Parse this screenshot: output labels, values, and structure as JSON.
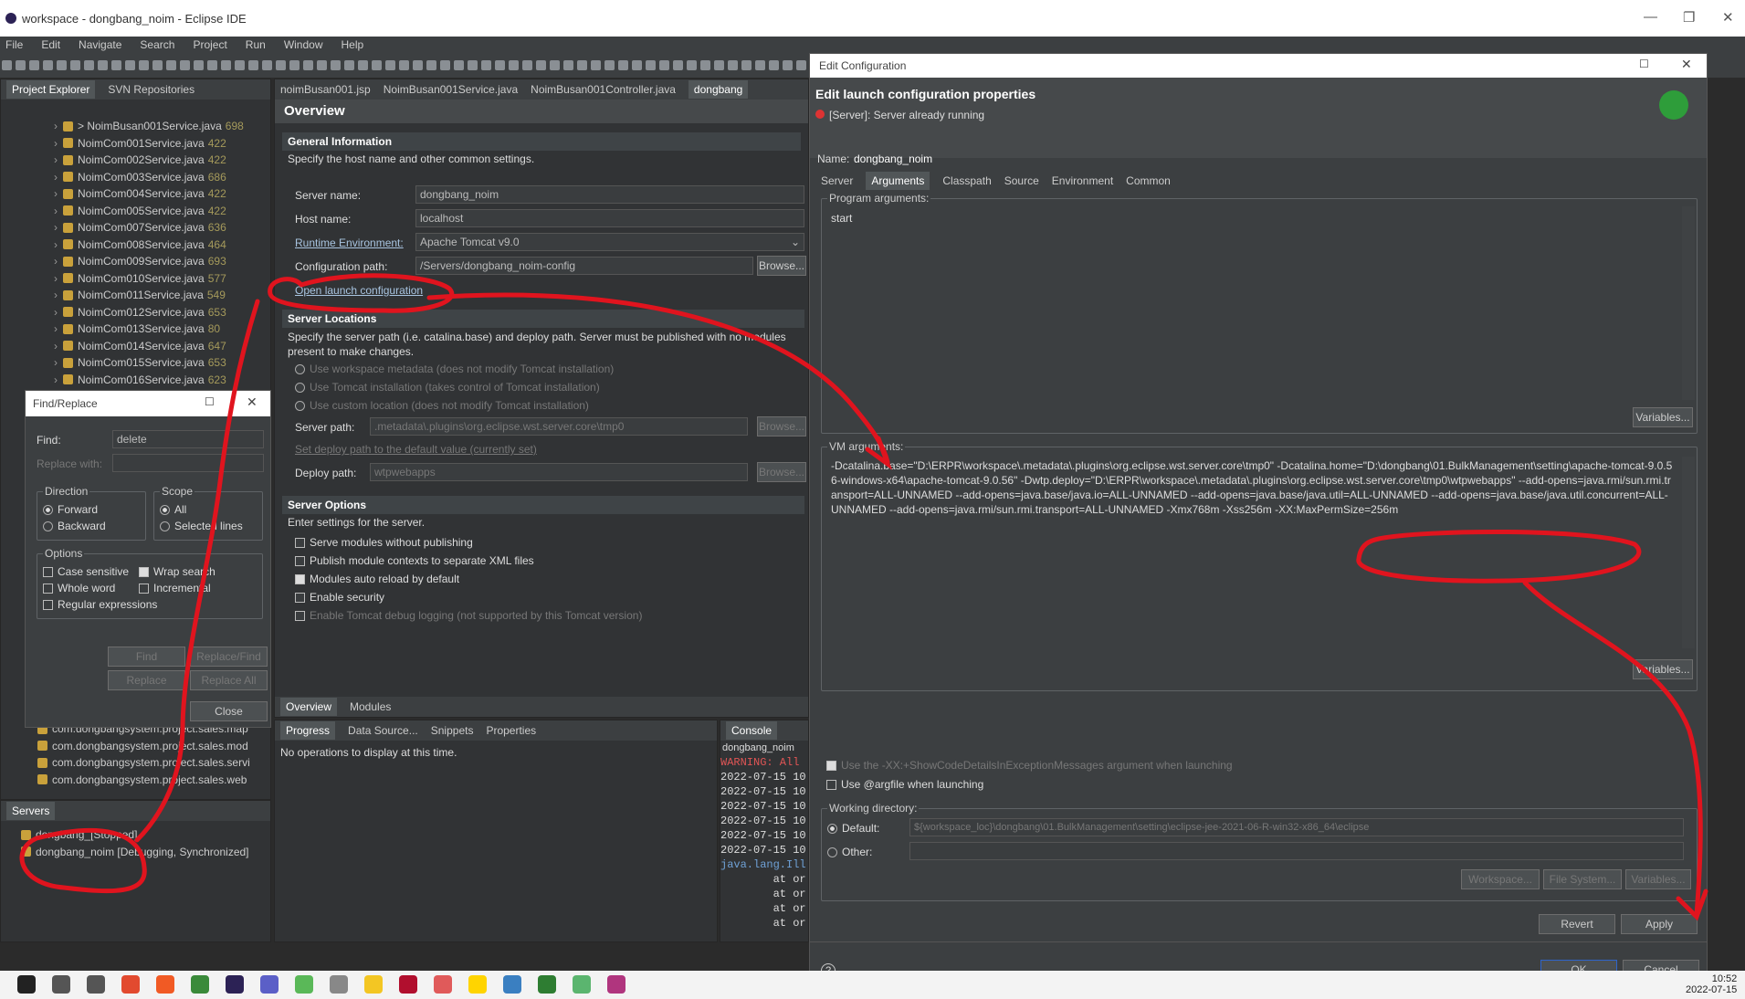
{
  "window": {
    "title": "workspace - dongbang_noim - Eclipse IDE"
  },
  "menu": [
    "File",
    "Edit",
    "Navigate",
    "Search",
    "Project",
    "Run",
    "Window",
    "Help"
  ],
  "explorer": {
    "tabs": [
      "Project Explorer",
      "SVN Repositories"
    ],
    "items": [
      {
        "name": "> NoimBusan001Service.java",
        "num": "698"
      },
      {
        "name": "NoimCom001Service.java",
        "num": "422"
      },
      {
        "name": "NoimCom002Service.java",
        "num": "422"
      },
      {
        "name": "NoimCom003Service.java",
        "num": "686"
      },
      {
        "name": "NoimCom004Service.java",
        "num": "422"
      },
      {
        "name": "NoimCom005Service.java",
        "num": "422"
      },
      {
        "name": "NoimCom007Service.java",
        "num": "636"
      },
      {
        "name": "NoimCom008Service.java",
        "num": "464"
      },
      {
        "name": "NoimCom009Service.java",
        "num": "693"
      },
      {
        "name": "NoimCom010Service.java",
        "num": "577"
      },
      {
        "name": "NoimCom011Service.java",
        "num": "549"
      },
      {
        "name": "NoimCom012Service.java",
        "num": "653"
      },
      {
        "name": "NoimCom013Service.java",
        "num": "80"
      },
      {
        "name": "NoimCom014Service.java",
        "num": "647"
      },
      {
        "name": "NoimCom015Service.java",
        "num": "653"
      },
      {
        "name": "NoimCom016Service.java",
        "num": "623"
      }
    ],
    "packages": [
      "com.dongbangsystem.project.sales.map",
      "com.dongbangsystem.project.sales.mod",
      "com.dongbangsystem.project.sales.servi",
      "com.dongbangsystem.project.sales.web"
    ]
  },
  "servers": {
    "tab": "Servers",
    "items": [
      "dongbang_[Stopped]",
      "dongbang_noim [Debugging, Synchronized]"
    ]
  },
  "findReplace": {
    "title": "Find/Replace",
    "find_label": "Find:",
    "find_value": "delete",
    "replace_label": "Replace with:",
    "direction": "Direction",
    "forward": "Forward",
    "backward": "Backward",
    "scope": "Scope",
    "scope_all": "All",
    "selected_lines": "Selected lines",
    "options": "Options",
    "case_sensitive": "Case sensitive",
    "wrap_search": "Wrap search",
    "whole_word": "Whole word",
    "incremental": "Incremental",
    "regex": "Regular expressions",
    "find_btn": "Find",
    "replace_find_btn": "Replace/Find",
    "replace_btn": "Replace",
    "replace_all_btn": "Replace All",
    "close_btn": "Close"
  },
  "editor": {
    "tabs": [
      "noimBusan001.jsp",
      "NoimBusan001Service.java",
      "NoimBusan001Controller.java",
      "dongbang"
    ],
    "title": "Overview",
    "general": {
      "title": "General Information",
      "desc": "Specify the host name and other common settings.",
      "server_name_label": "Server name:",
      "server_name": "dongbang_noim",
      "host_name_label": "Host name:",
      "host_name": "localhost",
      "runtime_label": "Runtime Environment:",
      "runtime": "Apache Tomcat v9.0",
      "config_label": "Configuration path:",
      "config": "/Servers/dongbang_noim-config",
      "browse": "Browse...",
      "open_launch": "Open launch configuration"
    },
    "locations": {
      "title": "Server Locations",
      "desc": "Specify the server path (i.e. catalina.base) and deploy path. Server must be published with no modules present to make changes.",
      "opt1": "Use workspace metadata (does not modify Tomcat installation)",
      "opt2": "Use Tomcat installation (takes control of Tomcat installation)",
      "opt3": "Use custom location (does not modify Tomcat installation)",
      "server_path_label": "Server path:",
      "server_path": ".metadata\\.plugins\\org.eclipse.wst.server.core\\tmp0",
      "set_default": "Set deploy path to the default value (currently set)",
      "deploy_label": "Deploy path:",
      "deploy": "wtpwebapps"
    },
    "options": {
      "title": "Server Options",
      "desc": "Enter settings for the server.",
      "o1": "Serve modules without publishing",
      "o2": "Publish module contexts to separate XML files",
      "o3": "Modules auto reload by default",
      "o4": "Enable security",
      "o5": "Enable Tomcat debug logging (not supported by this Tomcat version)"
    },
    "bottom_tabs": [
      "Overview",
      "Modules"
    ]
  },
  "bottom": {
    "tabs": [
      "Progress",
      "Data Source...",
      "Snippets",
      "Properties"
    ],
    "msg": "No operations to display at this time.",
    "console_tab": "Console",
    "console_head": "dongbang_noim",
    "console_lines": [
      "WARNING: All",
      "2022-07-15 10",
      "2022-07-15 10",
      "2022-07-15 10",
      "2022-07-15 10",
      "2022-07-15 10",
      "2022-07-15 10",
      "java.lang.Ill",
      "        at or",
      "        at or",
      "        at or",
      "        at or"
    ]
  },
  "dialog": {
    "title": "Edit Configuration",
    "heading": "Edit launch configuration properties",
    "error": "[Server]: Server already running",
    "name_label": "Name:",
    "name": "dongbang_noim",
    "tabs": [
      "Server",
      "Arguments",
      "Classpath",
      "Source",
      "Environment",
      "Common"
    ],
    "program_args_label": "Program arguments:",
    "program_args": "start",
    "variables": "Variables...",
    "vm_args_label": "VM arguments:",
    "vm_args": "-Dcatalina.base=\"D:\\ERPR\\workspace\\.metadata\\.plugins\\org.eclipse.wst.server.core\\tmp0\" -Dcatalina.home=\"D:\\dongbang\\01.BulkManagement\\setting\\apache-tomcat-9.0.56-windows-x64\\apache-tomcat-9.0.56\" -Dwtp.deploy=\"D:\\ERPR\\workspace\\.metadata\\.plugins\\org.eclipse.wst.server.core\\tmp0\\wtpwebapps\" --add-opens=java.rmi/sun.rmi.transport=ALL-UNNAMED --add-opens=java.base/java.io=ALL-UNNAMED --add-opens=java.base/java.util=ALL-UNNAMED --add-opens=java.base/java.util.concurrent=ALL-UNNAMED --add-opens=java.rmi/sun.rmi.transport=ALL-UNNAMED -Xmx768m -Xss256m -XX:MaxPermSize=256m",
    "show_code": "Use the -XX:+ShowCodeDetailsInExceptionMessages argument when launching",
    "argfile": "Use @argfile when launching",
    "workdir_label": "Working directory:",
    "default": "Default:",
    "default_path": "${workspace_loc}\\dongbang\\01.BulkManagement\\setting\\eclipse-jee-2021-06-R-win32-x86_64\\eclipse",
    "other": "Other:",
    "workspace_btn": "Workspace...",
    "filesystem_btn": "File System...",
    "vars_btn": "Variables...",
    "revert": "Revert",
    "apply": "Apply",
    "ok": "OK",
    "cancel": "Cancel"
  },
  "taskbar": {
    "time": "10:52",
    "date": "2022-07-15"
  },
  "colors": {
    "annotation": "#e0141e",
    "accent": "#2f65ca"
  }
}
